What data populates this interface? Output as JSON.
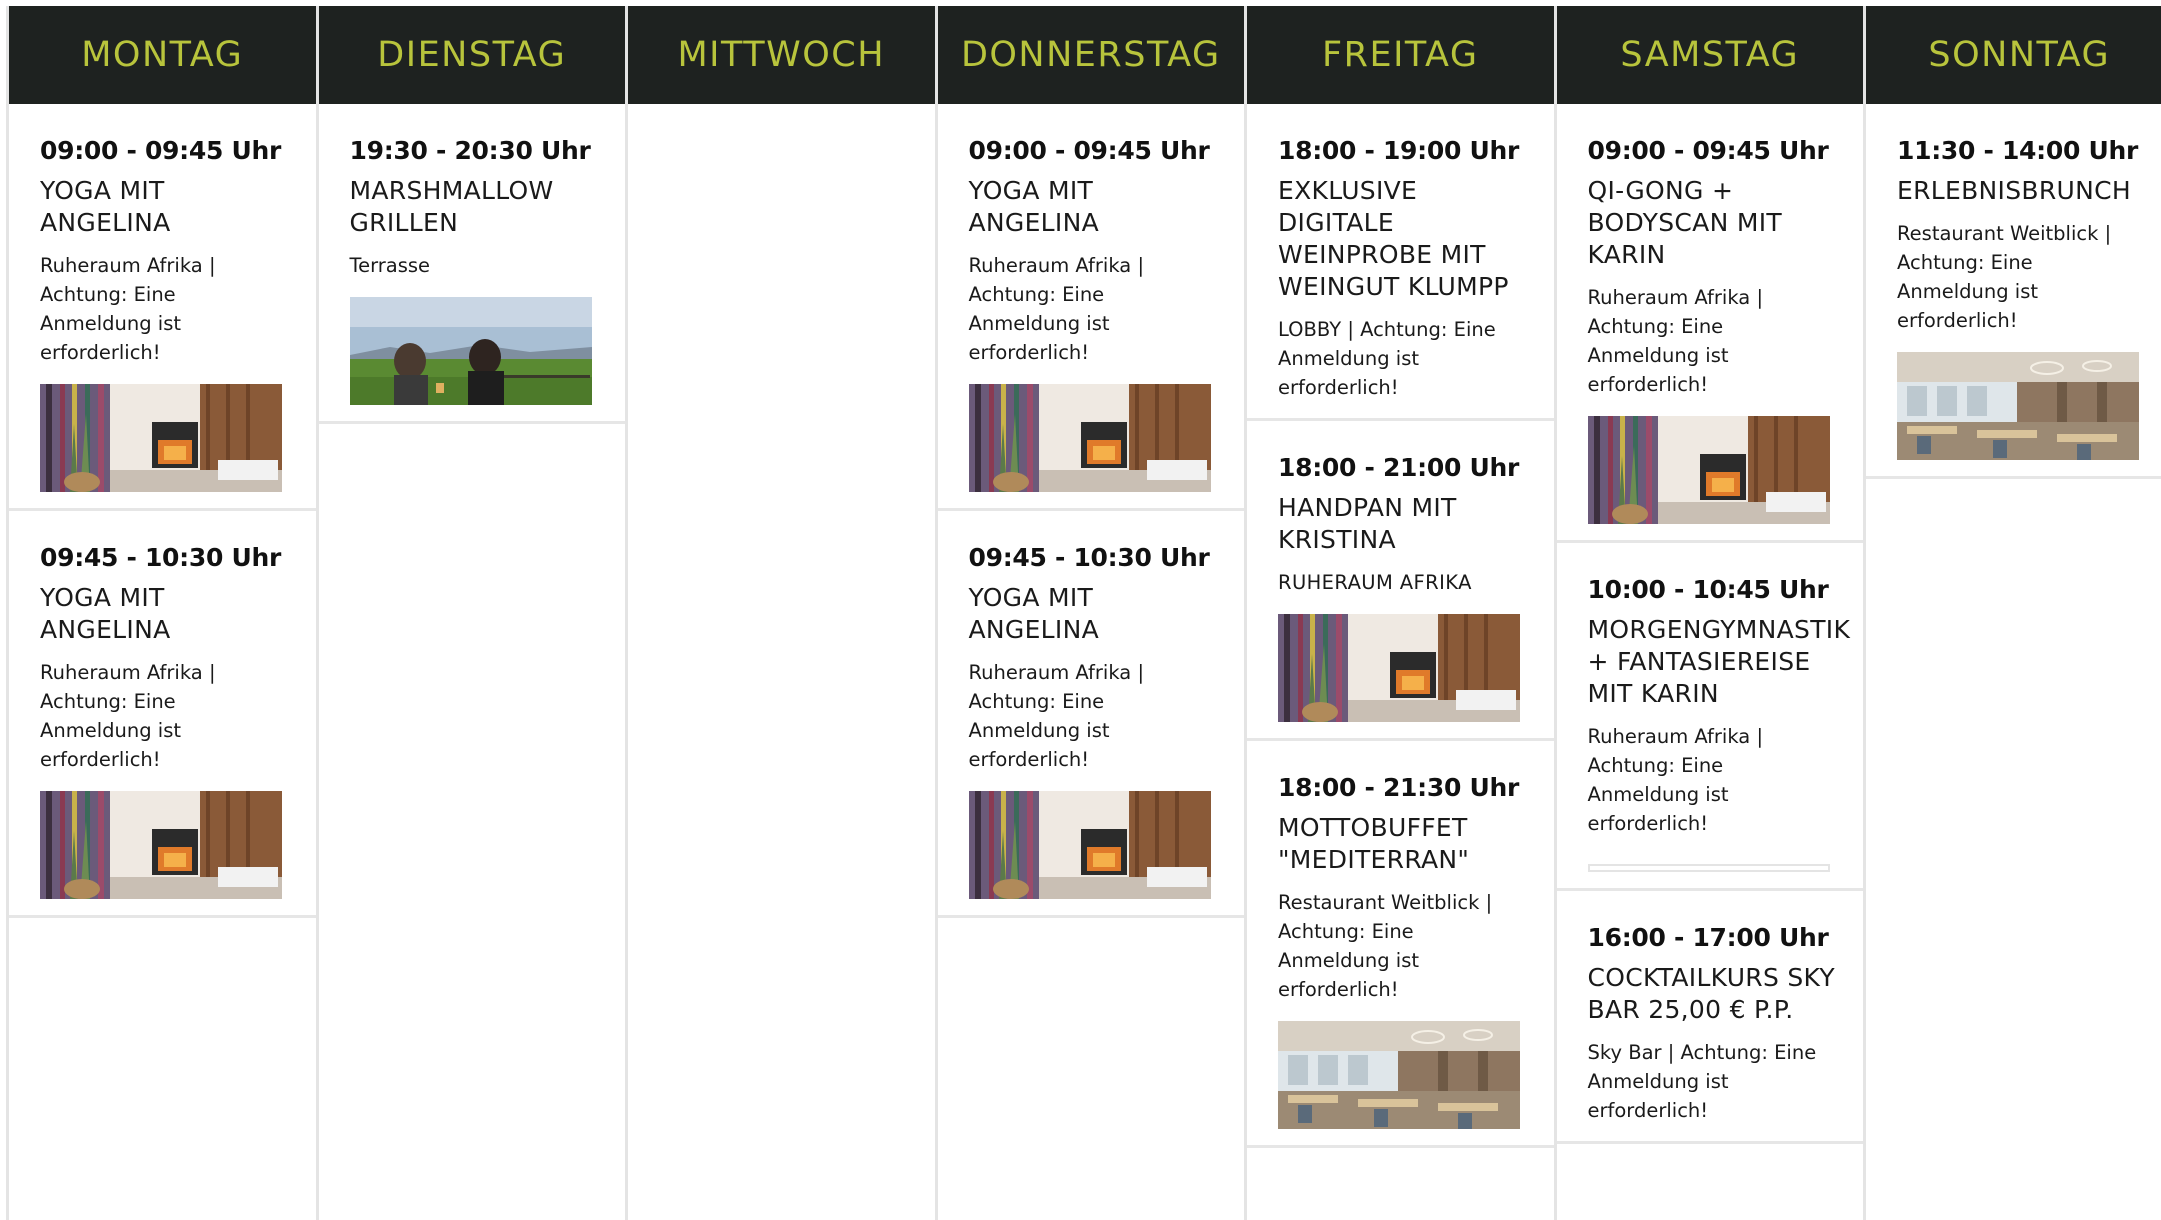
{
  "days": [
    {
      "name": "MONTAG",
      "events": [
        {
          "time": "09:00 - 09:45 Uhr",
          "title": "YOGA MIT ANGELINA",
          "location": "Ruheraum Afrika | Achtung: Eine Anmeldung ist erforderlich!",
          "image": "spa-fireplace-image"
        },
        {
          "time": "09:45 - 10:30 Uhr",
          "title": "YOGA MIT ANGELINA",
          "location": "Ruheraum Afrika | Achtung: Eine Anmeldung ist erforderlich!",
          "image": "spa-fireplace-image"
        }
      ]
    },
    {
      "name": "DIENSTAG",
      "events": [
        {
          "time": "19:30 - 20:30 Uhr",
          "title": "MARSHMALLOW GRILLEN",
          "location": "Terrasse",
          "image": "outdoor-people-image"
        }
      ]
    },
    {
      "name": "MITTWOCH",
      "events": []
    },
    {
      "name": "DONNERSTAG",
      "events": [
        {
          "time": "09:00 - 09:45 Uhr",
          "title": "YOGA MIT ANGELINA",
          "location": "Ruheraum Afrika | Achtung: Eine Anmeldung ist erforderlich!",
          "image": "spa-fireplace-image"
        },
        {
          "time": "09:45 - 10:30 Uhr",
          "title": "YOGA MIT ANGELINA",
          "location": "Ruheraum Afrika | Achtung: Eine Anmeldung ist erforderlich!",
          "image": "spa-fireplace-image"
        }
      ]
    },
    {
      "name": "FREITAG",
      "events": [
        {
          "time": "18:00 - 19:00 Uhr",
          "title": "EXKLUSIVE DIGITALE WEINPROBE MIT WEINGUT KLUMPP",
          "location": "LOBBY | Achtung: Eine Anmeldung ist erforderlich!",
          "image": ""
        },
        {
          "time": "18:00 - 21:00 Uhr",
          "title": "HANDPAN MIT KRISTINA",
          "location": "RUHERAUM AFRIKA",
          "image": "spa-fireplace-image"
        },
        {
          "time": "18:00 - 21:30 Uhr",
          "title": "MOTTOBUFFET \"MEDITERRAN\"",
          "location": "Restaurant Weitblick | Achtung: Eine Anmeldung ist erforderlich!",
          "image": "restaurant-image"
        }
      ]
    },
    {
      "name": "SAMSTAG",
      "events": [
        {
          "time": "09:00 - 09:45 Uhr",
          "title": "QI-GONG + BODYSCAN MIT KARIN",
          "location": "Ruheraum Afrika | Achtung: Eine Anmeldung ist erforderlich!",
          "image": "spa-fireplace-image"
        },
        {
          "time": "10:00 - 10:45 Uhr",
          "title": "MORGENGYMNASTIK + FANTASIEREISE MIT KARIN",
          "location": "Ruheraum Afrika | Achtung: Eine Anmeldung ist erforderlich!",
          "image": "empty-image"
        },
        {
          "time": "16:00 - 17:00 Uhr",
          "title": "COCKTAILKURS SKY BAR 25,00 € p.P.",
          "location": "Sky Bar | Achtung: Eine Anmeldung ist erforderlich!",
          "image": ""
        }
      ]
    },
    {
      "name": "SONNTAG",
      "events": [
        {
          "time": "11:30 - 14:00 Uhr",
          "title": "ERLEBNISBRUNCH",
          "location": "Restaurant Weitblick | Achtung: Eine Anmeldung ist erforderlich!",
          "image": "restaurant-image"
        }
      ]
    }
  ],
  "colors": {
    "header_bg": "#1e2220",
    "header_text": "#b8c43c",
    "divider": "#e4e4e4"
  }
}
